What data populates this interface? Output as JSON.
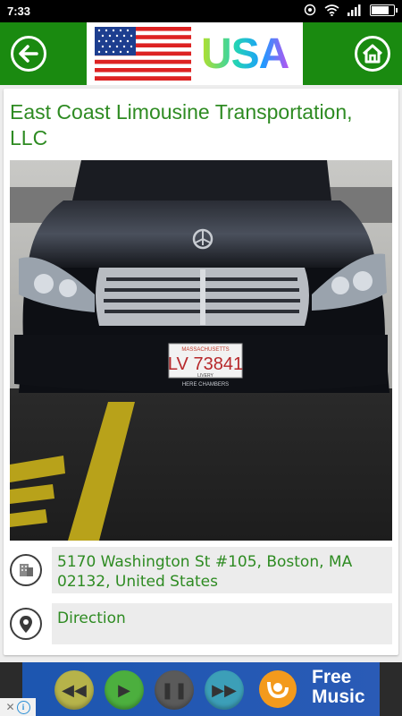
{
  "status_bar": {
    "time": "7:33",
    "icons": [
      "alarm-icon",
      "wifi-icon",
      "signal-icon",
      "battery-icon"
    ],
    "battery_fraction": 0.85
  },
  "header": {
    "back_icon": "arrow-left-icon",
    "flag_icon": "usa-flag-icon",
    "brand_text": "USA",
    "home_icon": "home-icon",
    "bar_color": "#1a8a10"
  },
  "listing": {
    "title": "East Coast Limousine Transportation, LLC",
    "photo": {
      "plate_text": "LV 73841",
      "plate_small": "LIVERY",
      "plate_bottom": "HERE CHAMBERS"
    },
    "address": {
      "icon": "building-icon",
      "text": "5170 Washington St #105, Boston, MA 02132, United States"
    },
    "direction": {
      "icon": "location-pin-icon",
      "label": "Direction"
    },
    "accent_color": "#2e8b22"
  },
  "ad": {
    "headline": "Free Music",
    "buttons": [
      "rewind-icon",
      "play-icon",
      "pause-icon",
      "fast-forward-icon"
    ],
    "app_icon": "uc-music-icon",
    "adchoices_icons": [
      "close-x-icon",
      "info-icon"
    ]
  }
}
